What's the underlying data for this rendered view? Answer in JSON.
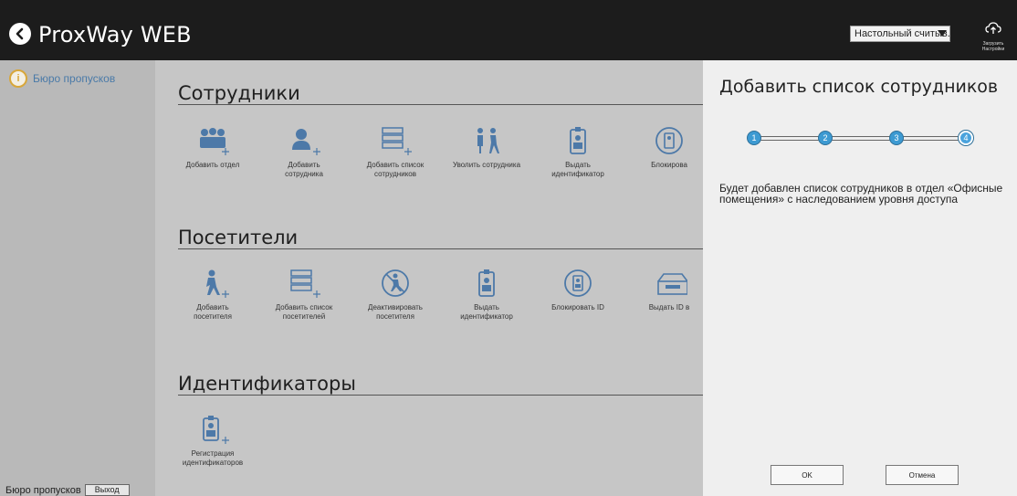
{
  "header": {
    "app_title": "ProxWay WEB",
    "reader_select": "Настольный считыв...",
    "upload_label_1": "Загрузить",
    "upload_label_2": "Настройки"
  },
  "sidebar": {
    "item_label": "Бюро пропусков",
    "footer_label": "Бюро пропусков",
    "logout_label": "Выход"
  },
  "sections": {
    "employees": {
      "title": "Сотрудники",
      "tiles": [
        {
          "l1": "Добавить отдел",
          "l2": ""
        },
        {
          "l1": "Добавить",
          "l2": "сотрудника"
        },
        {
          "l1": "Добавить список",
          "l2": "сотрудников"
        },
        {
          "l1": "Уволить сотрудника",
          "l2": ""
        },
        {
          "l1": "Выдать",
          "l2": "идентификатор"
        },
        {
          "l1": "Блокирова",
          "l2": ""
        }
      ]
    },
    "visitors": {
      "title": "Посетители",
      "tiles": [
        {
          "l1": "Добавить",
          "l2": "посетителя"
        },
        {
          "l1": "Добавить список",
          "l2": "посетителей"
        },
        {
          "l1": "Деактивировать",
          "l2": "посетителя"
        },
        {
          "l1": "Выдать",
          "l2": "идентификатор"
        },
        {
          "l1": "Блокировать ID",
          "l2": ""
        },
        {
          "l1": "Выдать ID в",
          "l2": ""
        }
      ]
    },
    "identifiers": {
      "title": "Идентификаторы",
      "tiles": [
        {
          "l1": "Регистрация",
          "l2": "идентификаторов"
        }
      ]
    }
  },
  "panel": {
    "title": "Добавить список сотрудников",
    "steps": [
      "1",
      "2",
      "3",
      "4"
    ],
    "description": "Будет добавлен список сотрудников в отдел «Офисные помещения» с наследованием уровня доступа",
    "ok_label": "OK",
    "cancel_label": "Отмена"
  },
  "colors": {
    "icon": "#4d79a8",
    "accent": "#3d9ad2",
    "topbar": "#1c1c1c"
  }
}
